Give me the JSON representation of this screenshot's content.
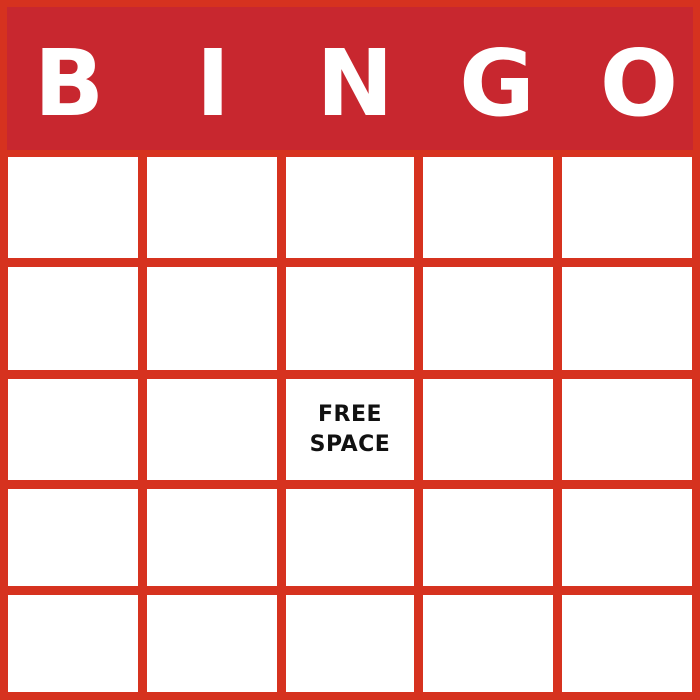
{
  "title_letters": [
    "B",
    "I",
    "N",
    "G",
    "O"
  ],
  "free_space": {
    "line1": "FREE",
    "line2": "SPACE"
  },
  "cells": [
    [
      "",
      "",
      "",
      "",
      ""
    ],
    [
      "",
      "",
      "",
      "",
      ""
    ],
    [
      "",
      "",
      "FREE SPACE",
      "",
      ""
    ],
    [
      "",
      "",
      "",
      "",
      ""
    ],
    [
      "",
      "",
      "",
      "",
      ""
    ]
  ],
  "colors": {
    "header_background": "#c8272f",
    "grid_lines": "#d6321f",
    "header_text": "#ffffff",
    "cell_background": "#ffffff",
    "cell_text": "#111111"
  }
}
